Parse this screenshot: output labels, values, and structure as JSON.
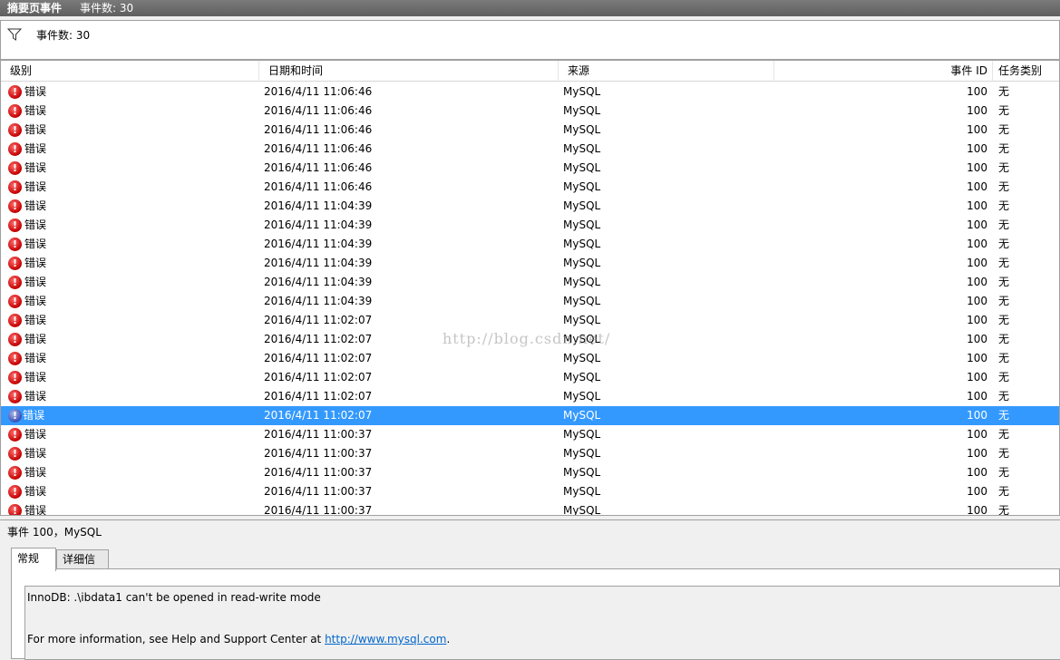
{
  "titlebar": {
    "title": "摘要页事件",
    "count": "事件数: 30"
  },
  "filter": {
    "count_label": "事件数: 30"
  },
  "columns": {
    "level": "级别",
    "datetime": "日期和时间",
    "source": "来源",
    "event_id": "事件 ID",
    "task": "任务类别"
  },
  "rows": [
    {
      "level": "错误",
      "datetime": "2016/4/11 11:06:46",
      "source": "MySQL",
      "event_id": "100",
      "task": "无"
    },
    {
      "level": "错误",
      "datetime": "2016/4/11 11:06:46",
      "source": "MySQL",
      "event_id": "100",
      "task": "无"
    },
    {
      "level": "错误",
      "datetime": "2016/4/11 11:06:46",
      "source": "MySQL",
      "event_id": "100",
      "task": "无"
    },
    {
      "level": "错误",
      "datetime": "2016/4/11 11:06:46",
      "source": "MySQL",
      "event_id": "100",
      "task": "无"
    },
    {
      "level": "错误",
      "datetime": "2016/4/11 11:06:46",
      "source": "MySQL",
      "event_id": "100",
      "task": "无"
    },
    {
      "level": "错误",
      "datetime": "2016/4/11 11:06:46",
      "source": "MySQL",
      "event_id": "100",
      "task": "无"
    },
    {
      "level": "错误",
      "datetime": "2016/4/11 11:04:39",
      "source": "MySQL",
      "event_id": "100",
      "task": "无"
    },
    {
      "level": "错误",
      "datetime": "2016/4/11 11:04:39",
      "source": "MySQL",
      "event_id": "100",
      "task": "无"
    },
    {
      "level": "错误",
      "datetime": "2016/4/11 11:04:39",
      "source": "MySQL",
      "event_id": "100",
      "task": "无"
    },
    {
      "level": "错误",
      "datetime": "2016/4/11 11:04:39",
      "source": "MySQL",
      "event_id": "100",
      "task": "无"
    },
    {
      "level": "错误",
      "datetime": "2016/4/11 11:04:39",
      "source": "MySQL",
      "event_id": "100",
      "task": "无"
    },
    {
      "level": "错误",
      "datetime": "2016/4/11 11:04:39",
      "source": "MySQL",
      "event_id": "100",
      "task": "无"
    },
    {
      "level": "错误",
      "datetime": "2016/4/11 11:02:07",
      "source": "MySQL",
      "event_id": "100",
      "task": "无"
    },
    {
      "level": "错误",
      "datetime": "2016/4/11 11:02:07",
      "source": "MySQL",
      "event_id": "100",
      "task": "无"
    },
    {
      "level": "错误",
      "datetime": "2016/4/11 11:02:07",
      "source": "MySQL",
      "event_id": "100",
      "task": "无"
    },
    {
      "level": "错误",
      "datetime": "2016/4/11 11:02:07",
      "source": "MySQL",
      "event_id": "100",
      "task": "无"
    },
    {
      "level": "错误",
      "datetime": "2016/4/11 11:02:07",
      "source": "MySQL",
      "event_id": "100",
      "task": "无"
    },
    {
      "level": "错误",
      "datetime": "2016/4/11 11:02:07",
      "source": "MySQL",
      "event_id": "100",
      "task": "无",
      "selected": true
    },
    {
      "level": "错误",
      "datetime": "2016/4/11 11:00:37",
      "source": "MySQL",
      "event_id": "100",
      "task": "无"
    },
    {
      "level": "错误",
      "datetime": "2016/4/11 11:00:37",
      "source": "MySQL",
      "event_id": "100",
      "task": "无"
    },
    {
      "level": "错误",
      "datetime": "2016/4/11 11:00:37",
      "source": "MySQL",
      "event_id": "100",
      "task": "无"
    },
    {
      "level": "错误",
      "datetime": "2016/4/11 11:00:37",
      "source": "MySQL",
      "event_id": "100",
      "task": "无"
    },
    {
      "level": "错误",
      "datetime": "2016/4/11 11:00:37",
      "source": "MySQL",
      "event_id": "100",
      "task": "无"
    }
  ],
  "watermark": "http://blog.csdn.net/",
  "detail": {
    "title": "事件 100，MySQL",
    "tabs": {
      "general": "常规",
      "details": "详细信息"
    },
    "message_line1": "InnoDB: .\\ibdata1 can't be opened in read-write mode",
    "message_line2_prefix": "For more information, see Help and Support Center at ",
    "message_link": "http://www.mysql.com",
    "message_line2_suffix": "."
  },
  "icons": {
    "filter": "funnel-icon",
    "error": "error-icon"
  }
}
